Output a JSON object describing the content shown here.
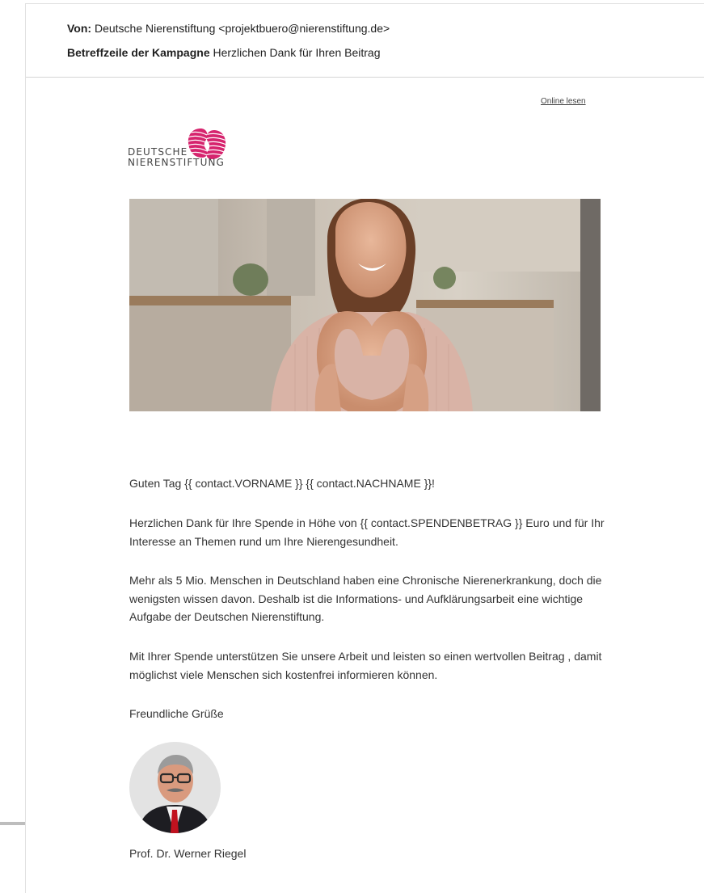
{
  "email": {
    "from_label": "Von:",
    "from_value": "Deutsche Nierenstiftung <projektbuero@nierenstiftung.de>",
    "subject_label": "Betreffzeile der Kampagne",
    "subject_value": "Herzlichen Dank für Ihren Beitrag"
  },
  "newsletter": {
    "online_link": "Online lesen",
    "logo": {
      "line1": "DEUTSCHE",
      "line2": "NIERENSTIFTUNG",
      "mark_icon": "kidney-mark-icon",
      "color": "#d6246e"
    },
    "hero_image": "woman-heart-hands-photo",
    "greeting": "Guten Tag {{ contact.VORNAME }} {{ contact.NACHNAME }}!",
    "paragraphs": [
      "Herzlichen Dank für Ihre Spende in Höhe von {{ contact.SPENDENBETRAG }} Euro und für Ihr Interesse an Themen rund um Ihre Nierengesundheit.",
      "Mehr als 5 Mio. Menschen in Deutschland haben eine Chronische Nierenerkrankung, doch die wenigsten wissen davon. Deshalb ist die Informations- und Aufklärungsarbeit eine wichtige Aufgabe der Deutschen Nierenstiftung.",
      "Mit Ihrer Spende unterstützen Sie unsere Arbeit und leisten so einen wertvollen Beitrag , damit möglichst viele Menschen sich kostenfrei informieren können."
    ],
    "closing": "Freundliche Grüße",
    "signature_photo": "portrait-photo",
    "signature_name": "Prof. Dr. Werner Riegel"
  }
}
